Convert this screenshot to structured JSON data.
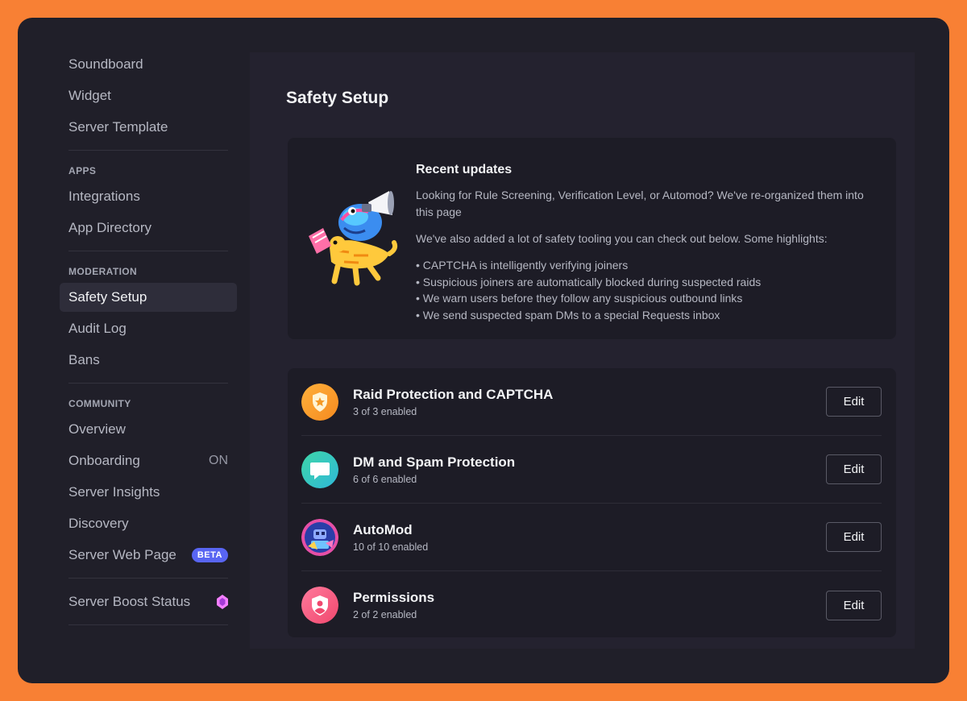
{
  "sidebar": {
    "top_items": [
      {
        "label": "Soundboard"
      },
      {
        "label": "Widget"
      },
      {
        "label": "Server Template"
      }
    ],
    "apps_heading": "APPS",
    "apps_items": [
      {
        "label": "Integrations"
      },
      {
        "label": "App Directory"
      }
    ],
    "moderation_heading": "MODERATION",
    "moderation_items": [
      {
        "label": "Safety Setup",
        "active": true
      },
      {
        "label": "Audit Log"
      },
      {
        "label": "Bans"
      }
    ],
    "community_heading": "COMMUNITY",
    "community_items": [
      {
        "label": "Overview"
      },
      {
        "label": "Onboarding",
        "suffix": "ON"
      },
      {
        "label": "Server Insights"
      },
      {
        "label": "Discovery"
      },
      {
        "label": "Server Web Page",
        "badge": "BETA"
      }
    ],
    "boost_item": {
      "label": "Server Boost Status",
      "icon": "boost-gem-icon"
    }
  },
  "main": {
    "title": "Safety Setup",
    "updates": {
      "title": "Recent updates",
      "para1": "Looking for Rule Screening, Verification Level, or Automod? We've re-organized them into this page",
      "para2": "We've also added a lot of safety tooling you can check out below. Some highlights:",
      "highlights": [
        "• CAPTCHA is intelligently verifying joiners",
        "• Suspicious joiners are automatically blocked during suspected raids",
        "• We warn users before they follow any suspicious outbound links",
        "• We send suspected spam DMs to a special Requests inbox"
      ]
    },
    "features": [
      {
        "title": "Raid Protection and CAPTCHA",
        "status": "3 of 3 enabled",
        "button": "Edit",
        "icon": "shield-star-icon"
      },
      {
        "title": "DM and Spam Protection",
        "status": "6 of 6 enabled",
        "button": "Edit",
        "icon": "chat-bubble-icon"
      },
      {
        "title": "AutoMod",
        "status": "10 of 10 enabled",
        "button": "Edit",
        "icon": "automod-robot-icon"
      },
      {
        "title": "Permissions",
        "status": "2 of 2 enabled",
        "button": "Edit",
        "icon": "shield-person-icon"
      }
    ]
  },
  "colors": {
    "background": "#f88034",
    "window": "#201f29",
    "content": "#24222f",
    "card": "#1d1c26",
    "accent": "#5865f2"
  }
}
